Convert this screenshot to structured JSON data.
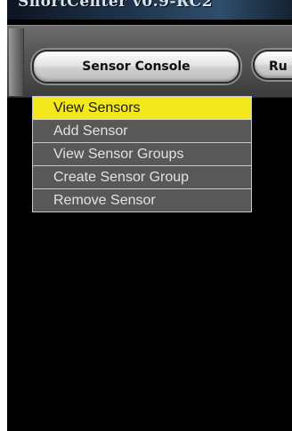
{
  "window": {
    "title": "SnortCenter v0.9-RC2"
  },
  "toolbar": {
    "buttons": [
      {
        "label": "Sensor Console"
      },
      {
        "label": "Ru"
      }
    ]
  },
  "menu": {
    "items": [
      {
        "label": "View Sensors",
        "highlighted": true
      },
      {
        "label": "Add Sensor"
      },
      {
        "label": "View Sensor Groups"
      },
      {
        "label": "Create Sensor Group"
      },
      {
        "label": "Remove Sensor"
      }
    ]
  },
  "colors": {
    "background": "#000000",
    "menu_bg": "#585858",
    "menu_text": "#e2e2e2",
    "menu_highlight": "#f2e81c",
    "menu_border": "#c8c8c8"
  }
}
